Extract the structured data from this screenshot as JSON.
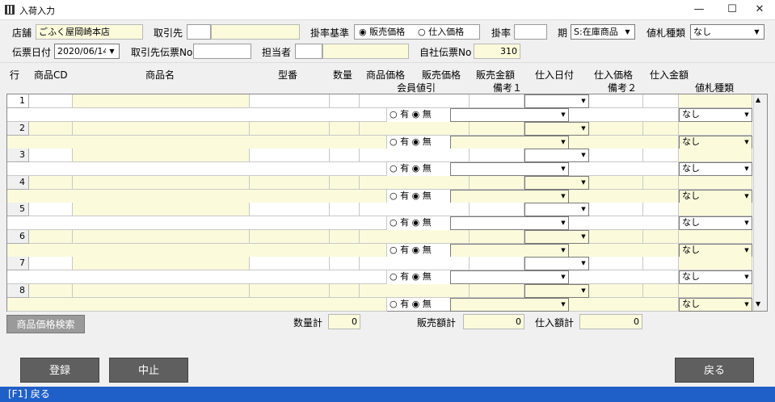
{
  "window": {
    "title": "入荷入力",
    "minimize": "—",
    "maximize": "☐",
    "close": "✕"
  },
  "header": {
    "store_label": "店舗",
    "store_value": "ごふく屋岡崎本店",
    "supplier_label": "取引先",
    "supplier_code": "",
    "supplier_name": "",
    "rate_basis_label": "掛率基準",
    "rate_basis_opt1": "販売価格",
    "rate_basis_opt2": "仕入価格",
    "rate_label": "掛率",
    "rate_value": "",
    "period_label": "期",
    "period_value": "S:在庫商品",
    "tag_type_label": "値札種類",
    "tag_type_value": "なし",
    "slip_date_label": "伝票日付",
    "slip_date_value": "2020/06/14",
    "supplier_slip_label": "取引先伝票No",
    "supplier_slip_value": "",
    "staff_label": "担当者",
    "staff_code": "",
    "staff_name": "",
    "own_slip_label": "自社伝票No",
    "own_slip_value": "310"
  },
  "columns": {
    "row": "行",
    "code": "商品CD",
    "name": "商品名",
    "model": "型番",
    "qty": "数量",
    "price": "商品価格",
    "sale_price": "販売価格",
    "sale_amount": "販売金額",
    "purchase_date": "仕入日付",
    "purchase_price": "仕入価格",
    "purchase_amount": "仕入金額",
    "member_discount": "会員値引",
    "note1": "備考１",
    "note2": "備考２",
    "tag_type": "値札種類"
  },
  "rows": [
    {
      "no": "1",
      "has": "有",
      "none": "無",
      "tag": "なし"
    },
    {
      "no": "2",
      "has": "有",
      "none": "無",
      "tag": "なし"
    },
    {
      "no": "3",
      "has": "有",
      "none": "無",
      "tag": "なし"
    },
    {
      "no": "4",
      "has": "有",
      "none": "無",
      "tag": "なし"
    },
    {
      "no": "5",
      "has": "有",
      "none": "無",
      "tag": "なし"
    },
    {
      "no": "6",
      "has": "有",
      "none": "無",
      "tag": "なし"
    },
    {
      "no": "7",
      "has": "有",
      "none": "無",
      "tag": "なし"
    },
    {
      "no": "8",
      "has": "有",
      "none": "無",
      "tag": "なし"
    }
  ],
  "footer": {
    "price_search": "商品価格検索",
    "qty_total_label": "数量計",
    "qty_total": "0",
    "sales_total_label": "販売額計",
    "sales_total": "0",
    "purchase_total_label": "仕入額計",
    "purchase_total": "0",
    "register": "登録",
    "cancel": "中止",
    "back": "戻る"
  },
  "status": "[F1] 戻る"
}
